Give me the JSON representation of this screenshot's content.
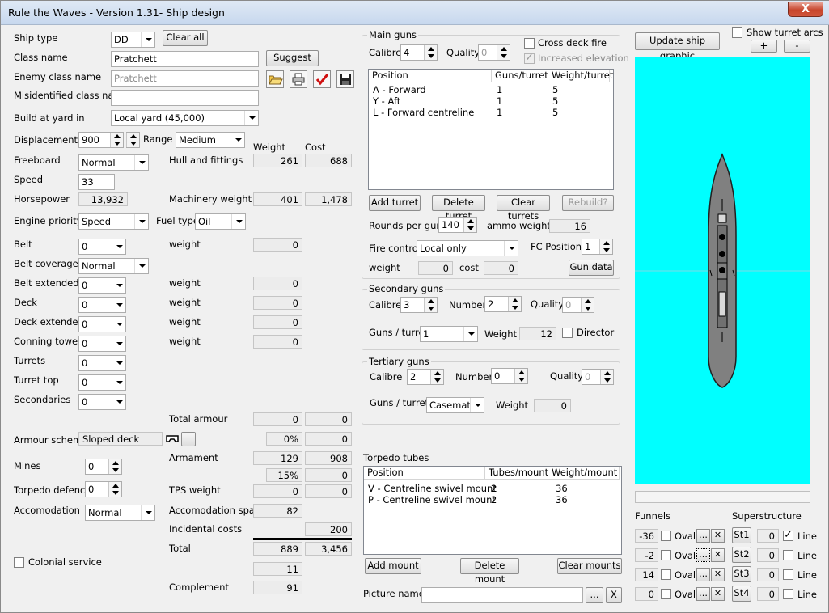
{
  "window": {
    "title": "Rule the Waves - Version 1.31- Ship design",
    "close": "X"
  },
  "left": {
    "ship_type_label": "Ship type",
    "ship_type": "DD",
    "clear_all": "Clear all",
    "class_name_label": "Class name",
    "class_name": "Pratchett",
    "suggest": "Suggest",
    "enemy_label": "Enemy class name",
    "enemy_value": "Pratchett",
    "misid_label": "Misidentified class name",
    "misid_value": "",
    "yard_label": "Build at yard in",
    "yard_value": "Local yard (45,000)",
    "disp_label": "Displacement",
    "disp_value": "900",
    "range_label": "Range",
    "range_value": "Medium",
    "weight_header": "Weight",
    "cost_header": "Cost",
    "freeboard_label": "Freeboard",
    "freeboard_value": "Normal",
    "hull_label": "Hull and fittings",
    "hull_weight": "261",
    "hull_cost": "688",
    "speed_label": "Speed",
    "speed_value": "33",
    "hp_label": "Horsepower",
    "hp_value": "13,932",
    "mach_label": "Machinery weight",
    "mach_weight": "401",
    "mach_cost": "1,478",
    "engine_label": "Engine priority",
    "engine_value": "Speed",
    "fuel_label": "Fuel type",
    "fuel_value": "Oil",
    "belt_label": "Belt",
    "belt_value": "0",
    "weight_label": "weight",
    "belt_weight": "0",
    "belt_cov_label": "Belt coverage",
    "belt_cov_value": "Normal",
    "belt_ext_label": "Belt extended",
    "belt_ext_value": "0",
    "belt_ext_weight": "0",
    "deck_label": "Deck",
    "deck_value": "0",
    "deck_weight": "0",
    "deck_ext_label": "Deck extended",
    "deck_ext_value": "0",
    "deck_ext_weight": "0",
    "ct_label": "Conning tower",
    "ct_value": "0",
    "ct_weight": "0",
    "turrets_label": "Turrets",
    "turrets_value": "0",
    "turret_top_label": "Turret top",
    "turret_top_value": "0",
    "secondaries_label": "Secondaries",
    "secondaries_value": "0",
    "total_armour_label": "Total armour",
    "total_armour_weight": "0",
    "total_armour_cost": "0",
    "armour_scheme_label": "Armour scheme",
    "armour_scheme_value": "Sloped deck",
    "armour_pct": "0%",
    "armour_pct2": "0",
    "armament_label": "Armament",
    "armament_weight": "129",
    "armament_cost": "908",
    "mines_label": "Mines",
    "mines_value": "0",
    "pct2": "15%",
    "pct2b": "0",
    "td_label": "Torpedo defence",
    "td_value": "0",
    "tps_label": "TPS weight",
    "tps_weight": "0",
    "tps_cost": "0",
    "accom_label": "Accomodation",
    "accom_value": "Normal",
    "accom_space_label": "Accomodation space",
    "accom_space": "82",
    "incidental_label": "Incidental costs",
    "incidental": "200",
    "total_label": "Total",
    "total_weight": "889",
    "total_cost": "3,456",
    "colonial_label": "Colonial service",
    "extra_value": "11",
    "complement_label": "Complement",
    "complement": "91"
  },
  "main_guns": {
    "title": "Main guns",
    "calibre_label": "Calibre",
    "calibre": "4",
    "quality_label": "Quality",
    "quality": "0",
    "cross_deck": "Cross deck fire",
    "increased_elev": "Increased elevation",
    "columns": [
      "Position",
      "Guns/turret",
      "Weight/turret"
    ],
    "rows": [
      [
        "A - Forward",
        "1",
        "5"
      ],
      [
        "Y - Aft",
        "1",
        "5"
      ],
      [
        "L - Forward centreline",
        "1",
        "5"
      ]
    ],
    "add_turret": "Add turret",
    "delete_turret": "Delete turret",
    "clear_turrets": "Clear turrets",
    "rebuild": "Rebuild?",
    "rpg_label": "Rounds per gun",
    "rpg": "140",
    "ammo_label": "ammo weight",
    "ammo": "16",
    "fc_label": "Fire control",
    "fc_value": "Local only",
    "fcpos_label": "FC Positions",
    "fcpos": "1",
    "fc_weight_label": "weight",
    "fc_weight": "0",
    "fc_cost_label": "cost",
    "fc_cost": "0",
    "gun_data": "Gun data"
  },
  "secondary": {
    "title": "Secondary guns",
    "calibre_label": "Calibre",
    "calibre": "3",
    "number_label": "Number",
    "number": "2",
    "quality_label": "Quality",
    "quality": "0",
    "gpt_label": "Guns / turret",
    "gpt": "1",
    "weight_label": "Weight",
    "weight": "12",
    "director": "Director"
  },
  "tertiary": {
    "title": "Tertiary guns",
    "calibre_label": "Calibre",
    "calibre": "2",
    "number_label": "Number",
    "number": "0",
    "quality_label": "Quality",
    "quality": "0",
    "gpt_label": "Guns / turret",
    "gpt": "Casemate",
    "weight_label": "Weight",
    "weight": "0"
  },
  "torpedo": {
    "title": "Torpedo tubes",
    "columns": [
      "Position",
      "Tubes/mount",
      "Weight/mount"
    ],
    "rows": [
      [
        "V - Centreline swivel mount",
        "2",
        "36"
      ],
      [
        "P - Centreline swivel mount",
        "2",
        "36"
      ]
    ],
    "add_mount": "Add mount",
    "delete_mount": "Delete mount",
    "clear_mounts": "Clear mounts"
  },
  "picture": {
    "label": "Picture name",
    "value": "",
    "browse": "...",
    "clear": "X"
  },
  "graphic": {
    "update": "Update ship graphic",
    "show_arcs": "Show turret arcs",
    "plus": "+",
    "minus": "-",
    "bg_color": "#00ffff",
    "hull_color": "#808080"
  },
  "funnels": {
    "title": "Funnels",
    "oval": "Oval",
    "rows": [
      "-36",
      "-2",
      "14",
      "0"
    ]
  },
  "superstructure": {
    "title": "Superstructure",
    "line": "Line",
    "rows": [
      {
        "name": "St1",
        "value": "0",
        "line": true
      },
      {
        "name": "St2",
        "value": "0",
        "line": false
      },
      {
        "name": "St3",
        "value": "0",
        "line": false
      },
      {
        "name": "St4",
        "value": "0",
        "line": false
      }
    ]
  }
}
